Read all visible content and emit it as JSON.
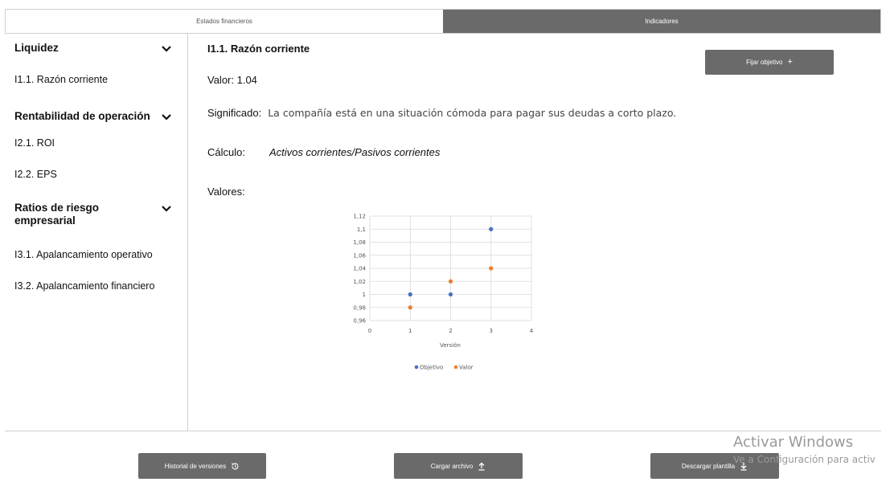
{
  "tabs": [
    {
      "label": "Estados financieros",
      "active": false
    },
    {
      "label": "Indicadores",
      "active": true
    }
  ],
  "sidebar": {
    "sections": [
      {
        "title": "Liquidez",
        "items": [
          "I1.1. Razón corriente"
        ]
      },
      {
        "title": "Rentabilidad de operación",
        "items": [
          "I2.1. ROI",
          "I2.2. EPS"
        ]
      },
      {
        "title": "Ratios de riesgo empresarial",
        "items": [
          "I3.1. Apalancamiento operativo",
          "I3.2. Apalancamiento financiero"
        ]
      }
    ]
  },
  "detail": {
    "title": "I1.1. Razón corriente",
    "value_text": "Valor: 1.04",
    "meaning_label": "Significado:",
    "meaning_text": "La compañía está en una situación cómoda para pagar sus deudas a corto plazo.",
    "calc_label": "Cálculo:",
    "calc_text": "Activos corrientes/Pasivos corrientes",
    "values_label": "Valores:",
    "set_goal_label": "Fijar objetivo"
  },
  "footer": {
    "history_label": "Historial de versiones",
    "upload_label": "Cargar archivo",
    "download_label": "Descargar plantilla"
  },
  "watermark": {
    "line1": "Activar Windows",
    "line2": "Ve a Configuración para activ"
  },
  "colors": {
    "objetivo": "#4472c4",
    "valor": "#ed7d31",
    "button": "#6a6a6a"
  },
  "chart_data": {
    "type": "scatter",
    "xlabel": "Versión",
    "xlim": [
      0,
      4
    ],
    "ylim": [
      0.96,
      1.12
    ],
    "x_ticks": [
      "0",
      "1",
      "2",
      "3",
      "4"
    ],
    "y_ticks": [
      "0,96",
      "0,98",
      "1",
      "1,02",
      "1,04",
      "1,06",
      "1,08",
      "1,1",
      "1,12"
    ],
    "legend_position": "bottom",
    "series": [
      {
        "name": "Objetivo",
        "x": [
          1,
          2,
          3
        ],
        "y": [
          1.0,
          1.0,
          1.1
        ]
      },
      {
        "name": "Valor",
        "x": [
          1,
          2,
          3
        ],
        "y": [
          0.98,
          1.02,
          1.04
        ]
      }
    ]
  }
}
